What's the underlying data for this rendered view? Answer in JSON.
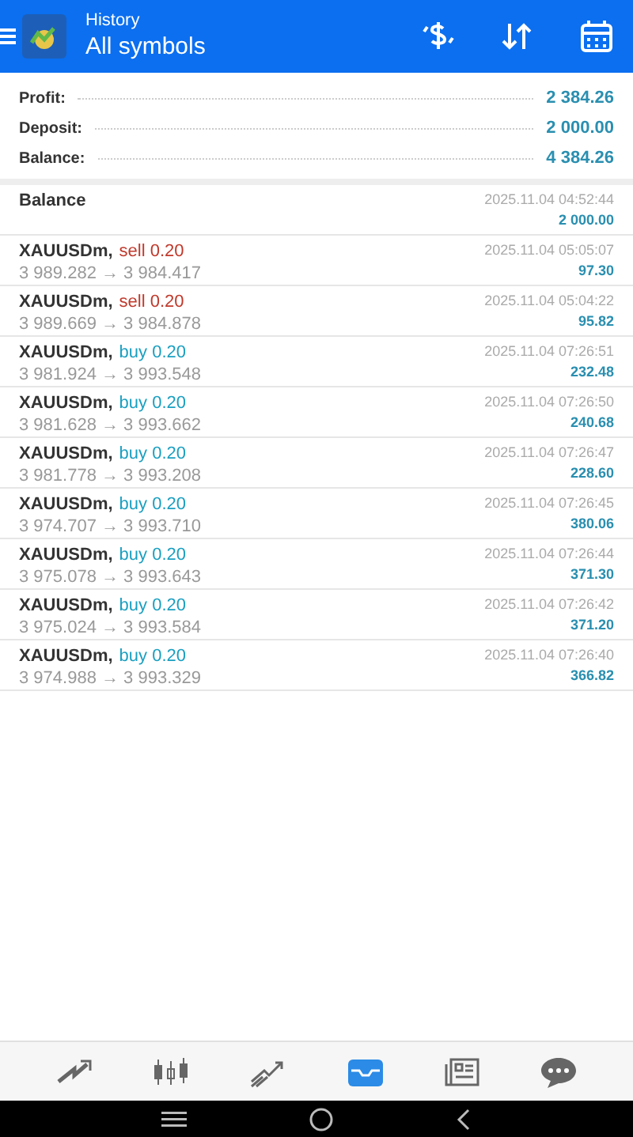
{
  "header": {
    "subtitle": "History",
    "title": "All symbols"
  },
  "summary": [
    {
      "label": "Profit:",
      "value": "2 384.26"
    },
    {
      "label": "Deposit:",
      "value": "2 000.00"
    },
    {
      "label": "Balance:",
      "value": "4 384.26"
    }
  ],
  "deals": [
    {
      "kind": "balance",
      "title": "Balance",
      "time": "2025.11.04 04:52:44",
      "amount": "2 000.00"
    },
    {
      "kind": "trade",
      "symbol": "XAUUSDm,",
      "side": "sell",
      "volume": "0.20",
      "prices": "3 989.282 → 3 984.417",
      "time": "2025.11.04 05:05:07",
      "amount": "97.30"
    },
    {
      "kind": "trade",
      "symbol": "XAUUSDm,",
      "side": "sell",
      "volume": "0.20",
      "prices": "3 989.669 → 3 984.878",
      "time": "2025.11.04 05:04:22",
      "amount": "95.82"
    },
    {
      "kind": "trade",
      "symbol": "XAUUSDm,",
      "side": "buy",
      "volume": "0.20",
      "prices": "3 981.924 → 3 993.548",
      "time": "2025.11.04 07:26:51",
      "amount": "232.48"
    },
    {
      "kind": "trade",
      "symbol": "XAUUSDm,",
      "side": "buy",
      "volume": "0.20",
      "prices": "3 981.628 → 3 993.662",
      "time": "2025.11.04 07:26:50",
      "amount": "240.68"
    },
    {
      "kind": "trade",
      "symbol": "XAUUSDm,",
      "side": "buy",
      "volume": "0.20",
      "prices": "3 981.778 → 3 993.208",
      "time": "2025.11.04 07:26:47",
      "amount": "228.60"
    },
    {
      "kind": "trade",
      "symbol": "XAUUSDm,",
      "side": "buy",
      "volume": "0.20",
      "prices": "3 974.707 → 3 993.710",
      "time": "2025.11.04 07:26:45",
      "amount": "380.06"
    },
    {
      "kind": "trade",
      "symbol": "XAUUSDm,",
      "side": "buy",
      "volume": "0.20",
      "prices": "3 975.078 → 3 993.643",
      "time": "2025.11.04 07:26:44",
      "amount": "371.30"
    },
    {
      "kind": "trade",
      "symbol": "XAUUSDm,",
      "side": "buy",
      "volume": "0.20",
      "prices": "3 975.024 → 3 993.584",
      "time": "2025.11.04 07:26:42",
      "amount": "371.20"
    },
    {
      "kind": "trade",
      "symbol": "XAUUSDm,",
      "side": "buy",
      "volume": "0.20",
      "prices": "3 974.988 → 3 993.329",
      "time": "2025.11.04 07:26:40",
      "amount": "366.82"
    }
  ],
  "nav": [
    {
      "kind": "quotes",
      "selected": false
    },
    {
      "kind": "chart",
      "selected": false
    },
    {
      "kind": "trade",
      "selected": false
    },
    {
      "kind": "history",
      "selected": true
    },
    {
      "kind": "news",
      "selected": false
    },
    {
      "kind": "chat",
      "selected": false
    }
  ]
}
